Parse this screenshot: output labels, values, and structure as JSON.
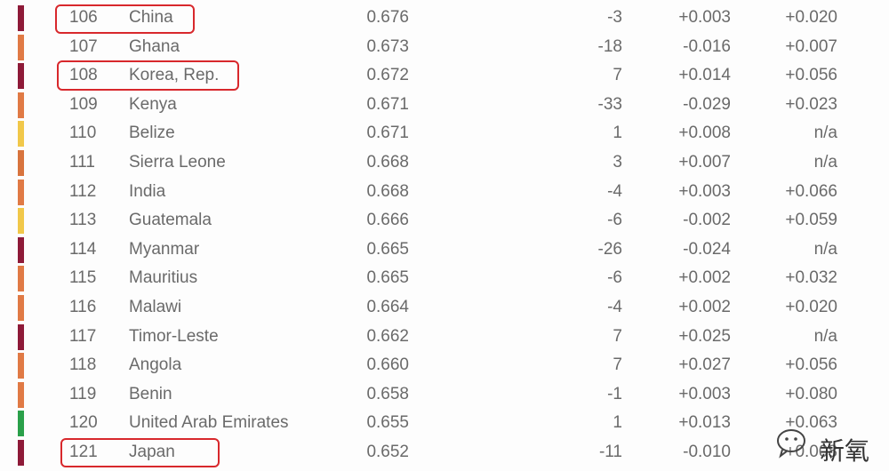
{
  "colors": {
    "dark_red": "#8e1a38",
    "orange": "#e07a45",
    "yellow": "#f1c84a",
    "green": "#2aa04a",
    "highlight": "#d8282c"
  },
  "rows": [
    {
      "rank": "106",
      "country": "China",
      "score": "0.676",
      "rank_change": "-3",
      "diff1": "+0.003",
      "diff2": "+0.020",
      "region_color": "#8e1a38",
      "highlighted": true
    },
    {
      "rank": "107",
      "country": "Ghana",
      "score": "0.673",
      "rank_change": "-18",
      "diff1": "-0.016",
      "diff2": "+0.007",
      "region_color": "#e07a45",
      "highlighted": false
    },
    {
      "rank": "108",
      "country": "Korea, Rep.",
      "score": "0.672",
      "rank_change": "7",
      "diff1": "+0.014",
      "diff2": "+0.056",
      "region_color": "#8e1a38",
      "highlighted": true
    },
    {
      "rank": "109",
      "country": "Kenya",
      "score": "0.671",
      "rank_change": "-33",
      "diff1": "-0.029",
      "diff2": "+0.023",
      "region_color": "#e07a45",
      "highlighted": false
    },
    {
      "rank": "110",
      "country": "Belize",
      "score": "0.671",
      "rank_change": "1",
      "diff1": "+0.008",
      "diff2": "n/a",
      "region_color": "#f1c84a",
      "highlighted": false
    },
    {
      "rank": "111",
      "country": "Sierra Leone",
      "score": "0.668",
      "rank_change": "3",
      "diff1": "+0.007",
      "diff2": "n/a",
      "region_color": "#d8743e",
      "highlighted": false
    },
    {
      "rank": "112",
      "country": "India",
      "score": "0.668",
      "rank_change": "-4",
      "diff1": "+0.003",
      "diff2": "+0.066",
      "region_color": "#e07a45",
      "highlighted": false
    },
    {
      "rank": "113",
      "country": "Guatemala",
      "score": "0.666",
      "rank_change": "-6",
      "diff1": "-0.002",
      "diff2": "+0.059",
      "region_color": "#f1c84a",
      "highlighted": false
    },
    {
      "rank": "114",
      "country": "Myanmar",
      "score": "0.665",
      "rank_change": "-26",
      "diff1": "-0.024",
      "diff2": "n/a",
      "region_color": "#8e1a38",
      "highlighted": false
    },
    {
      "rank": "115",
      "country": "Mauritius",
      "score": "0.665",
      "rank_change": "-6",
      "diff1": "+0.002",
      "diff2": "+0.032",
      "region_color": "#e07a45",
      "highlighted": false
    },
    {
      "rank": "116",
      "country": "Malawi",
      "score": "0.664",
      "rank_change": "-4",
      "diff1": "+0.002",
      "diff2": "+0.020",
      "region_color": "#e07a45",
      "highlighted": false
    },
    {
      "rank": "117",
      "country": "Timor-Leste",
      "score": "0.662",
      "rank_change": "7",
      "diff1": "+0.025",
      "diff2": "n/a",
      "region_color": "#8e1a38",
      "highlighted": false
    },
    {
      "rank": "118",
      "country": "Angola",
      "score": "0.660",
      "rank_change": "7",
      "diff1": "+0.027",
      "diff2": "+0.056",
      "region_color": "#e07a45",
      "highlighted": false
    },
    {
      "rank": "119",
      "country": "Benin",
      "score": "0.658",
      "rank_change": "-1",
      "diff1": "+0.003",
      "diff2": "+0.080",
      "region_color": "#e07a45",
      "highlighted": false
    },
    {
      "rank": "120",
      "country": "United Arab Emirates",
      "score": "0.655",
      "rank_change": "1",
      "diff1": "+0.013",
      "diff2": "+0.063",
      "region_color": "#2aa04a",
      "highlighted": false
    },
    {
      "rank": "121",
      "country": "Japan",
      "score": "0.652",
      "rank_change": "-11",
      "diff1": "-0.010",
      "diff2": "+0.008",
      "region_color": "#8e1a38",
      "highlighted": true
    }
  ],
  "watermark": {
    "text": "新氧",
    "icon": "wechat-icon"
  }
}
